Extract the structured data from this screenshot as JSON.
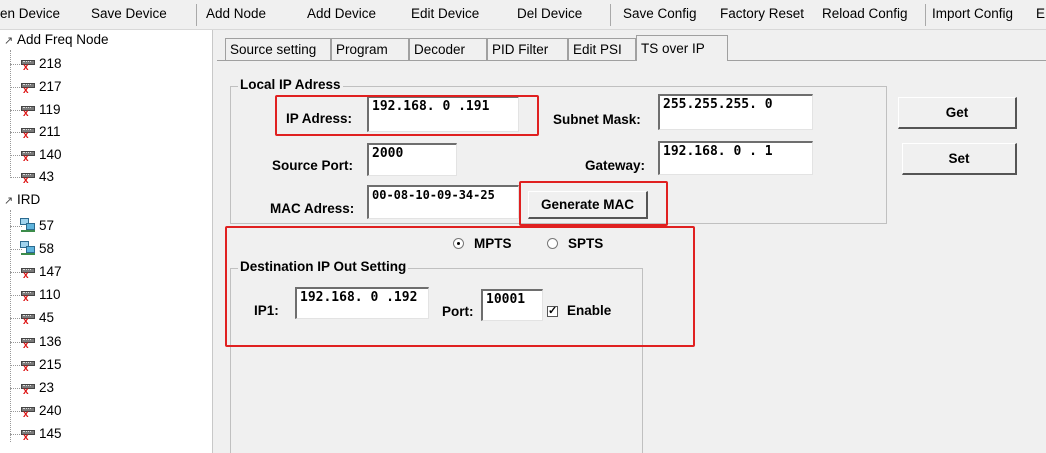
{
  "menu": [
    "en Device",
    "Save Device",
    "Add Node",
    "Add Device",
    "Edit Device",
    "Del Device",
    "Save Config",
    "Factory Reset",
    "Reload Config",
    "Import Config",
    "E"
  ],
  "tree": {
    "group1": {
      "label": "Add Freq Node",
      "items": [
        "218",
        "217",
        "119",
        "211",
        "140",
        "43"
      ]
    },
    "group2": {
      "label": "IRD",
      "ird_items": [
        "57",
        "58"
      ],
      "items": [
        "147",
        "110",
        "45",
        "136",
        "215",
        "23",
        "240",
        "145"
      ]
    }
  },
  "tabs": [
    "Source setting",
    "Program",
    "Decoder",
    "PID Filter",
    "Edit PSI",
    "TS over IP"
  ],
  "active_tab": "TS over IP",
  "local": {
    "title": "Local IP Adress",
    "ip_label": "IP Adress:",
    "ip_value": "192.168. 0 .191",
    "subnet_label": "Subnet Mask:",
    "subnet_value": "255.255.255. 0",
    "source_port_label": "Source Port:",
    "source_port_value": "2000",
    "gateway_label": "Gateway:",
    "gateway_value": "192.168. 0 . 1",
    "mac_label": "MAC Adress:",
    "mac_value": "00-08-10-09-34-25",
    "generate_mac_label": "Generate MAC"
  },
  "buttons": {
    "get": "Get",
    "set": "Set"
  },
  "mode": {
    "mpts": "MPTS",
    "spts": "SPTS",
    "selected": "MPTS"
  },
  "dest": {
    "title": "Destination IP Out Setting",
    "ip1_label": "IP1:",
    "ip1_value": "192.168. 0 .192",
    "port_label": "Port:",
    "port_value": "10001",
    "enable_label": "Enable",
    "enable_checked": true
  },
  "colors": {
    "highlight": "#e02020"
  }
}
